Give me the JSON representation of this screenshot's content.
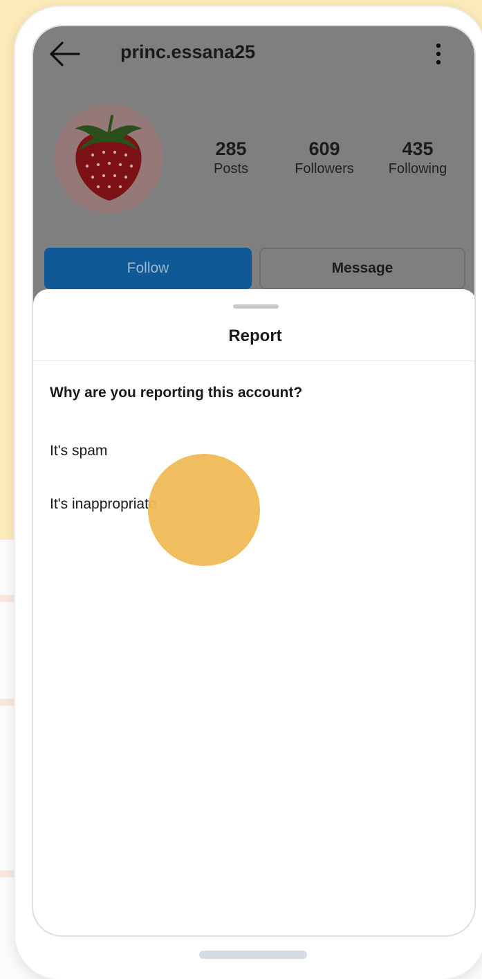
{
  "header": {
    "username": "princ.essana25"
  },
  "stats": [
    {
      "value": "285",
      "label": "Posts"
    },
    {
      "value": "609",
      "label": "Followers"
    },
    {
      "value": "435",
      "label": "Following"
    }
  ],
  "buttons": {
    "follow": "Follow",
    "message": "Message"
  },
  "report_sheet": {
    "title": "Report",
    "question": "Why are you reporting this account?",
    "options": [
      "It's spam",
      "It's inappropriate"
    ]
  },
  "colors": {
    "background_yellow": "#fdeab9",
    "follow_blue": "#0f5a96",
    "tap_indicator": "#efba56"
  }
}
